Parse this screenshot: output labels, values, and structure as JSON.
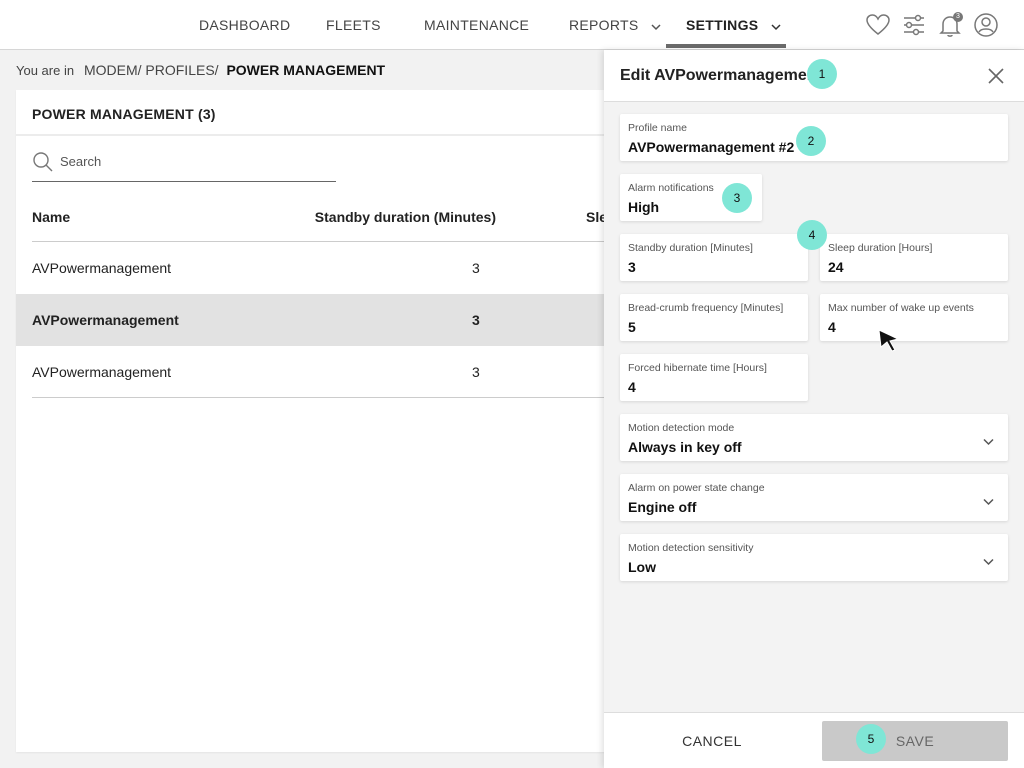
{
  "nav": {
    "items": [
      {
        "label": "DASHBOARD"
      },
      {
        "label": "FLEETS"
      },
      {
        "label": "MAINTENANCE"
      },
      {
        "label": "REPORTS"
      },
      {
        "label": "SETTINGS"
      }
    ],
    "active": "SETTINGS",
    "notification_count": "3",
    "icons": [
      "heart-icon",
      "sliders-icon",
      "bell-icon",
      "user-icon"
    ]
  },
  "breadcrumb": {
    "prefix": "You are in",
    "path": "MODEM/ PROFILES/",
    "current": "POWER MANAGEMENT"
  },
  "list": {
    "title": "POWER MANAGEMENT (3)",
    "search_placeholder": "Search",
    "columns": [
      "Name",
      "Standby duration (Minutes)",
      "Sle"
    ],
    "rows": [
      {
        "name": "AVPowermanagement",
        "standby": "3"
      },
      {
        "name": "AVPowermanagement",
        "standby": "3"
      },
      {
        "name": "AVPowermanagement",
        "standby": "3"
      }
    ]
  },
  "drawer": {
    "title": "Edit AVPowermanagement",
    "fields": {
      "profile_name": {
        "label": "Profile name",
        "value": "AVPowermanagement #2"
      },
      "alarm_notifications": {
        "label": "Alarm notifications",
        "value": "High"
      },
      "standby_duration": {
        "label": "Standby duration  [Minutes]",
        "value": "3"
      },
      "sleep_duration": {
        "label": "Sleep duration [Hours]",
        "value": "24"
      },
      "breadcrumb_frequency": {
        "label": "Bread-crumb frequency [Minutes]",
        "value": "5"
      },
      "max_wake_events": {
        "label": "Max number of wake up events",
        "value": "4"
      },
      "forced_hibernate": {
        "label": "Forced hibernate time [Hours]",
        "value": "4"
      },
      "motion_detection_mode": {
        "label": "Motion detection mode",
        "value": "Always in key off"
      },
      "alarm_power_state": {
        "label": "Alarm on power state change",
        "value": "Engine off"
      },
      "motion_sensitivity": {
        "label": "Motion detection sensitivity",
        "value": "Low"
      }
    },
    "cancel_label": "CANCEL",
    "save_label": "SAVE"
  },
  "markers": [
    "1",
    "2",
    "3",
    "4",
    "5"
  ],
  "colors": {
    "marker": "#7fe6d6",
    "selected_row": "#e2e2e2",
    "save_disabled": "#c9c9c9"
  }
}
